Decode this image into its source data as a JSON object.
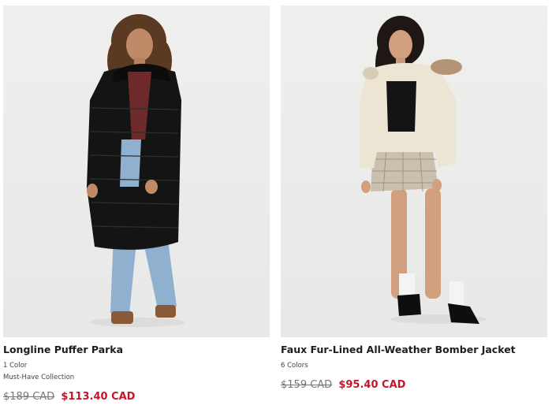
{
  "products": [
    {
      "name": "Longline Puffer Parka",
      "colors": "1 Color",
      "collection": "Must-Have Collection",
      "original_price": "$189 CAD",
      "sale_price": "$113.40 CAD",
      "image_label": "woman-in-black-longline-puffer-parka"
    },
    {
      "name": "Faux Fur-Lined All-Weather Bomber Jacket",
      "colors": "6 Colors",
      "original_price": "$159 CAD",
      "sale_price": "$95.40 CAD",
      "image_label": "woman-in-cream-faux-fur-bomber-jacket"
    }
  ],
  "colors": {
    "sale": "#c4162a",
    "strike": "#777777",
    "photo_bg": "#ececeb"
  }
}
